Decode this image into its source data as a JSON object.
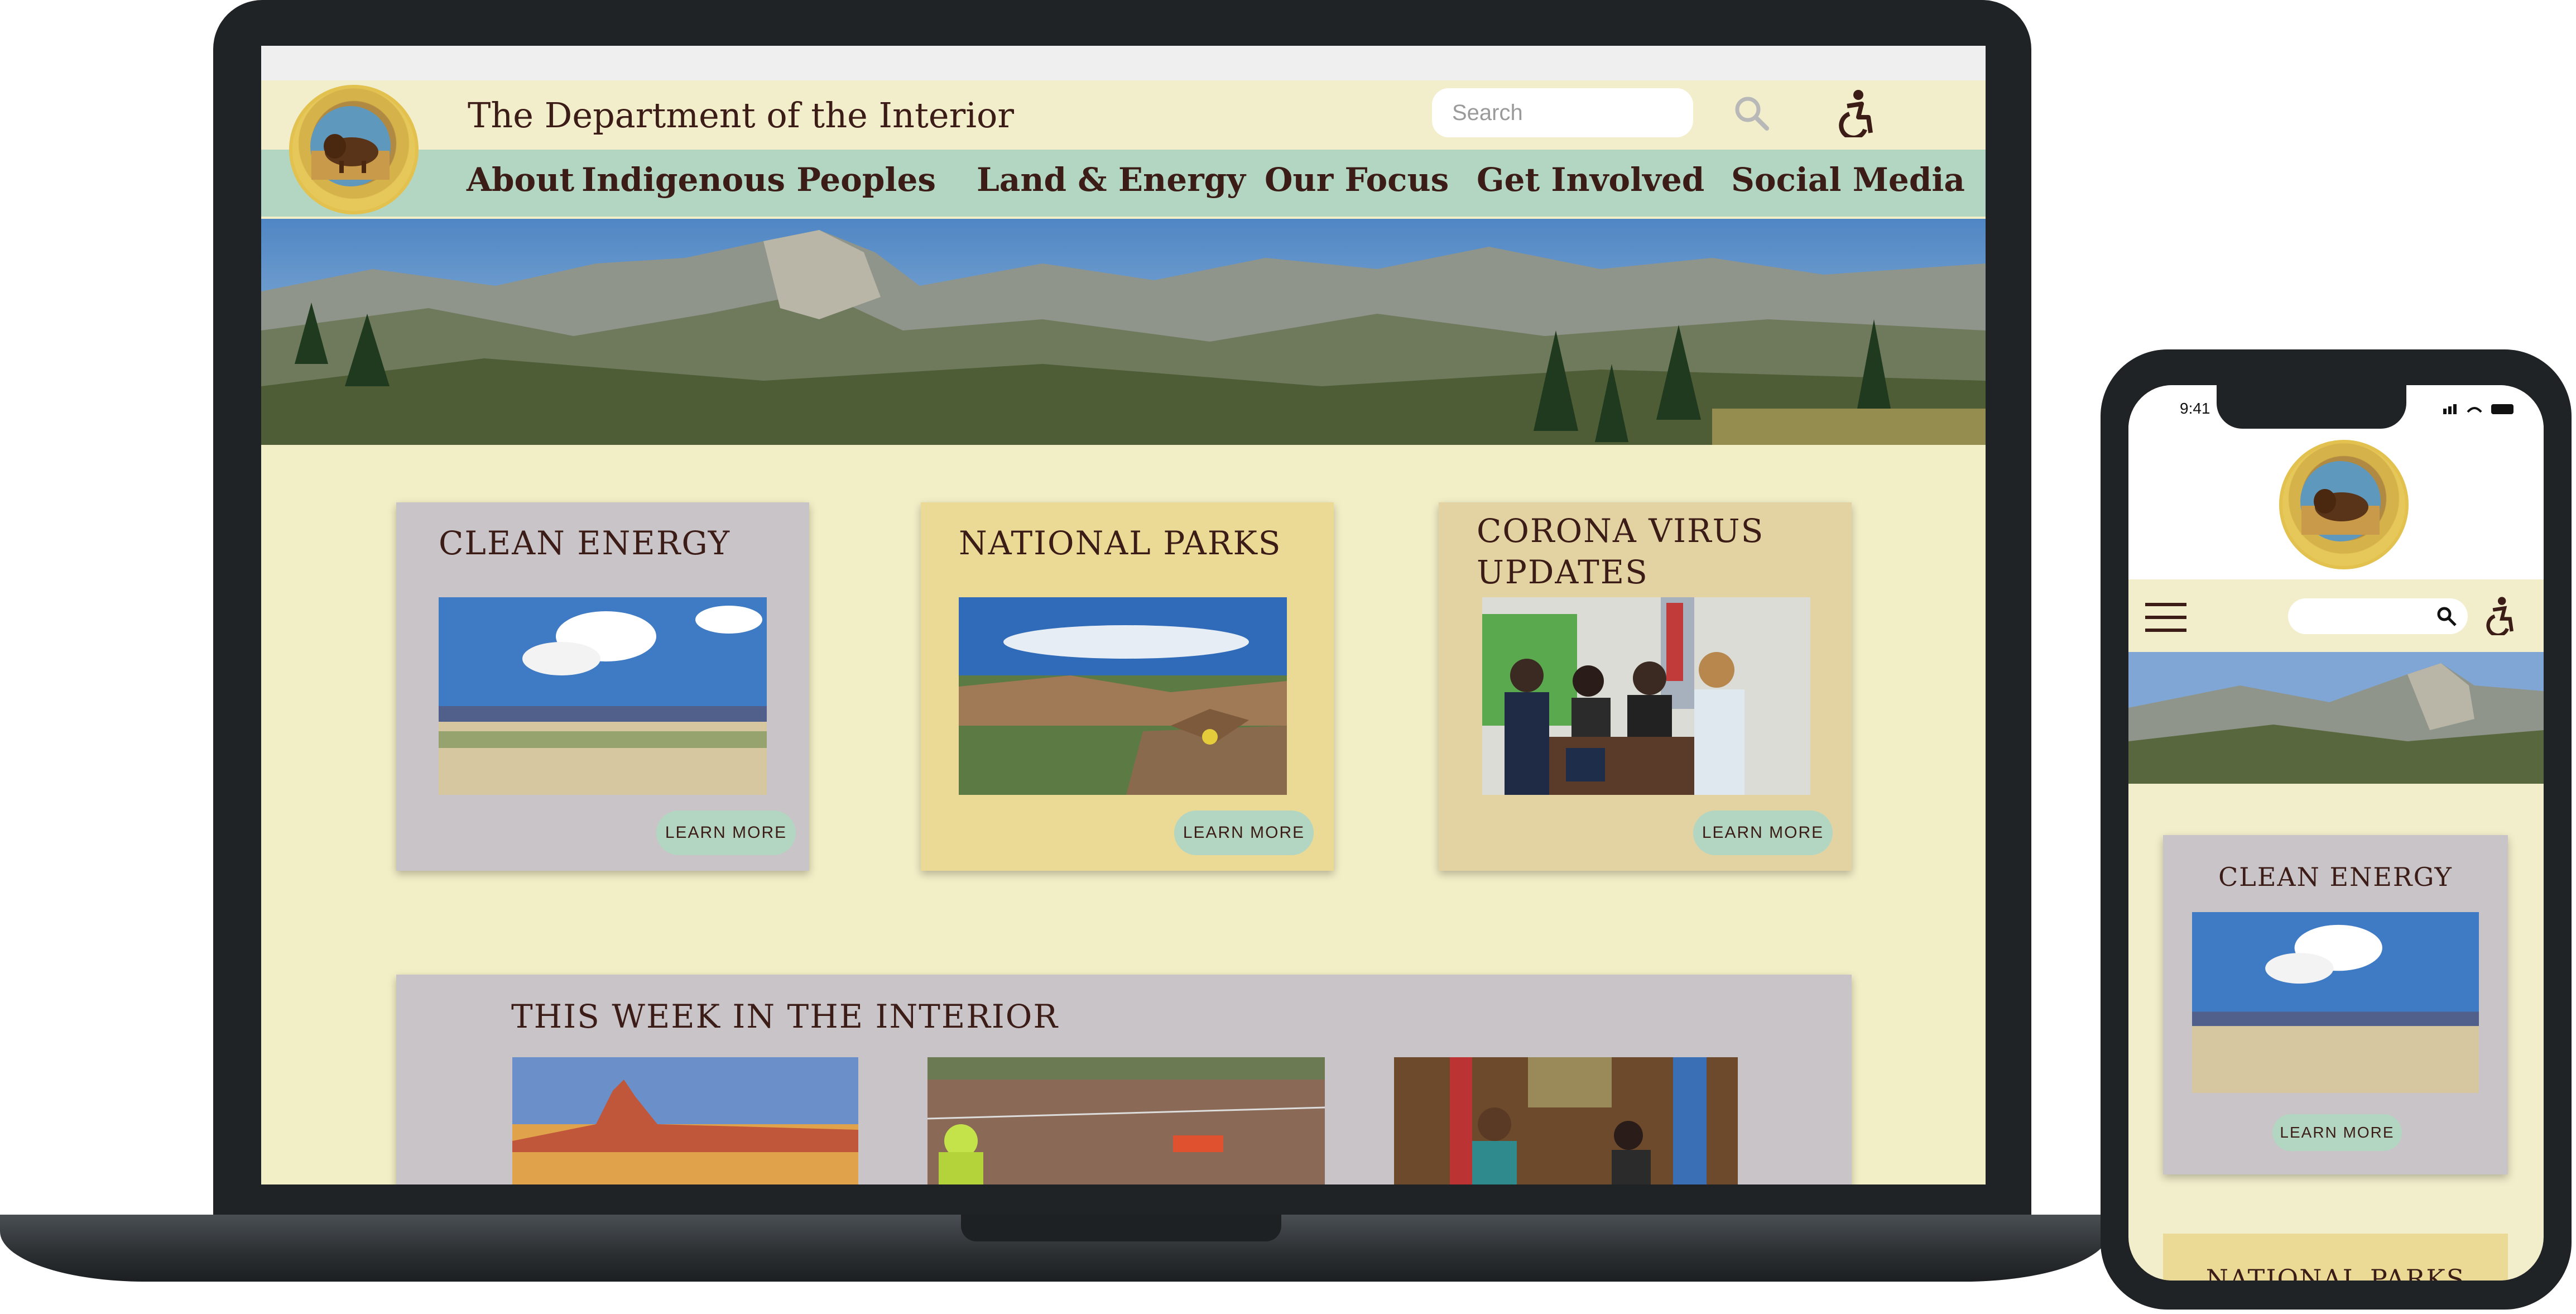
{
  "desktop": {
    "header": {
      "title": "The Department of the Interior",
      "search_placeholder": "Search"
    },
    "nav": [
      "About",
      "Indigenous Peoples",
      "Land & Energy",
      "Our Focus",
      "Get Involved",
      "Social Media"
    ],
    "cards": [
      {
        "title": "CLEAN ENERGY",
        "button": "LEARN MORE"
      },
      {
        "title": "NATIONAL PARKS",
        "button": "LEARN MORE"
      },
      {
        "title_line1": "CORONA VIRUS",
        "title_line2": "UPDATES",
        "button": "LEARN MORE"
      }
    ],
    "week_section": {
      "title": "THIS WEEK IN THE INTERIOR"
    }
  },
  "phone": {
    "status_time": "9:41",
    "card": {
      "title": "CLEAN ENERGY",
      "button": "LEARN MORE"
    },
    "next_card_title": "NATIONAL PARKS"
  },
  "colors": {
    "page_bg": "#f2eec6",
    "nav_bg": "#b2d6c1",
    "card_gray": "#c9c4c8",
    "card_yellow": "#ebd996",
    "card_tan": "#e3d3a2",
    "text_brown": "#3b1c16"
  }
}
